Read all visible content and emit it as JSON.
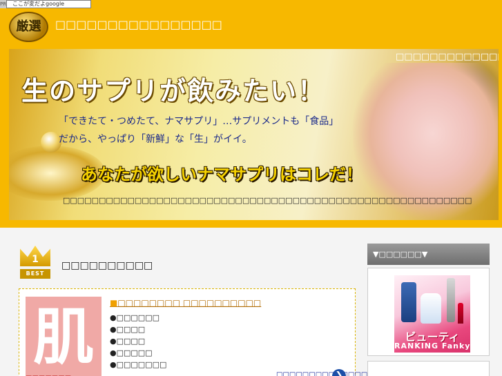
{
  "topbar": {
    "tag": "PR",
    "input_text": "ここが変だよgoogle"
  },
  "header": {
    "logo_text": "厳選",
    "site_title": "□□□□□□□□□□□□□□□□"
  },
  "banner": {
    "caption": "□□□□□□□□□□□□□□□□",
    "headline": "生のサプリが飲みたい！",
    "line1": "「できたて・つめたて、ナマサプリ」…サプリメントも「食品」",
    "line2": "だから、やっぱり「新鮮」な「生」がイイ。",
    "cta": "あなたが欲しいナマサプリはコレだ！",
    "description": "□□□□□□□□□□□□□□□□□□□□□□□□□□□□□□□□□□□□□□□□□□□□□□□□□□□□□□□□□"
  },
  "ranking": {
    "crown_number": "1",
    "crown_label": "BEST",
    "title": "□□□□□□□□□□",
    "product": {
      "thumb_glyph": "肌",
      "thumb_tag": "■□□□□□□",
      "link": "□□□□□□□□ □□□□□□□□□□",
      "features": [
        "●□□□□□□",
        "●□□□□",
        "●□□□□",
        "●□□□□□",
        "●□□□□□□□"
      ],
      "more_link": "□□□□□□□□□□□□□□",
      "more_arrow": "❯"
    }
  },
  "sidebar": {
    "heading": "▼□□□□□□▼",
    "ad": {
      "title": "ビューティ",
      "subtitle": "RANKING Fanky"
    }
  }
}
